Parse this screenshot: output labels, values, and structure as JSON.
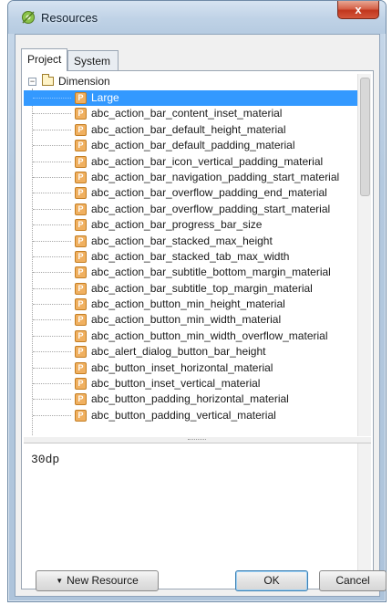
{
  "window": {
    "title": "Resources",
    "close_label": "x"
  },
  "tabs": [
    {
      "label": "Project",
      "active": true
    },
    {
      "label": "System",
      "active": false
    }
  ],
  "tree": {
    "root_label": "Dimension",
    "expander": "−",
    "item_icon_letter": "P",
    "items": [
      {
        "label": "Large",
        "selected": true
      },
      {
        "label": "abc_action_bar_content_inset_material"
      },
      {
        "label": "abc_action_bar_default_height_material"
      },
      {
        "label": "abc_action_bar_default_padding_material"
      },
      {
        "label": "abc_action_bar_icon_vertical_padding_material"
      },
      {
        "label": "abc_action_bar_navigation_padding_start_material"
      },
      {
        "label": "abc_action_bar_overflow_padding_end_material"
      },
      {
        "label": "abc_action_bar_overflow_padding_start_material"
      },
      {
        "label": "abc_action_bar_progress_bar_size"
      },
      {
        "label": "abc_action_bar_stacked_max_height"
      },
      {
        "label": "abc_action_bar_stacked_tab_max_width"
      },
      {
        "label": "abc_action_bar_subtitle_bottom_margin_material"
      },
      {
        "label": "abc_action_bar_subtitle_top_margin_material"
      },
      {
        "label": "abc_action_button_min_height_material"
      },
      {
        "label": "abc_action_button_min_width_material"
      },
      {
        "label": "abc_action_button_min_width_overflow_material"
      },
      {
        "label": "abc_alert_dialog_button_bar_height"
      },
      {
        "label": "abc_button_inset_horizontal_material"
      },
      {
        "label": "abc_button_inset_vertical_material"
      },
      {
        "label": "abc_button_padding_horizontal_material"
      },
      {
        "label": "abc_button_padding_vertical_material"
      }
    ]
  },
  "value": {
    "text": "30dp"
  },
  "buttons": {
    "new_resource": "New Resource",
    "new_resource_arrow": "▼",
    "ok": "OK",
    "cancel": "Cancel"
  },
  "colors": {
    "selection": "#3399ff",
    "close_button": "#c1361d",
    "resource_icon": "#f0b060"
  }
}
